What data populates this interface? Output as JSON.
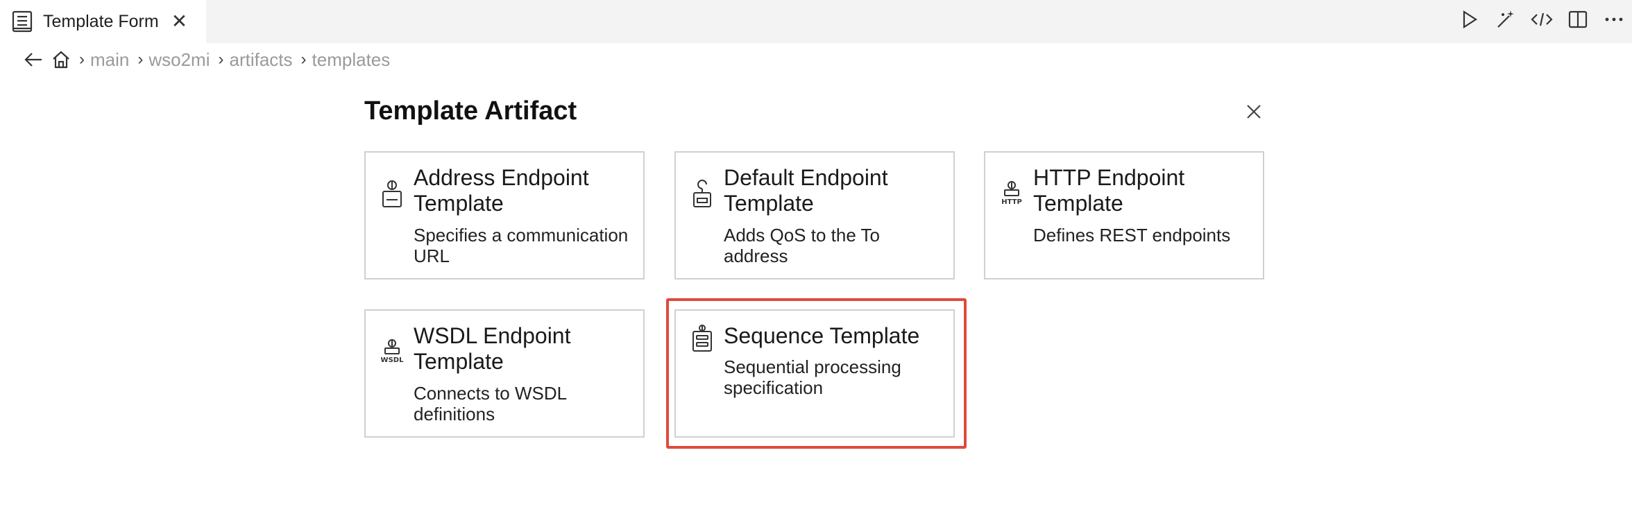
{
  "tab": {
    "title": "Template Form"
  },
  "breadcrumb": [
    "main",
    "wso2mi",
    "artifacts",
    "templates"
  ],
  "form": {
    "title": "Template Artifact"
  },
  "cards": [
    {
      "title": "Address Endpoint Template",
      "description": "Specifies a communication URL",
      "icon": "address-endpoint-icon"
    },
    {
      "title": "Default Endpoint Template",
      "description": "Adds QoS to the To address",
      "icon": "default-endpoint-icon"
    },
    {
      "title": "HTTP Endpoint Template",
      "description": "Defines REST endpoints",
      "icon": "http-endpoint-icon",
      "icon_label": "HTTP"
    },
    {
      "title": "WSDL Endpoint Template",
      "description": "Connects to WSDL definitions",
      "icon": "wsdl-endpoint-icon",
      "icon_label": "WSDL"
    },
    {
      "title": "Sequence Template",
      "description": "Sequential processing specification",
      "icon": "sequence-icon"
    }
  ],
  "highlight_color": "#e04a3b"
}
